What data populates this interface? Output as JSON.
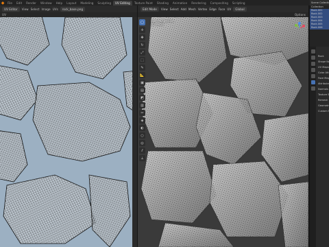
{
  "topbar": {
    "tabs": [
      "File",
      "Edit",
      "Render",
      "Window",
      "Help",
      "Layout",
      "Modeling",
      "Sculpting",
      "UV Editing",
      "Texture Paint",
      "Shading",
      "Animation",
      "Rendering",
      "Compositing",
      "Scripting"
    ],
    "active_tab": "UV Editing",
    "scene": "Scene"
  },
  "uv_editor": {
    "mode_label": "UV Editor",
    "menus": [
      "View",
      "Select",
      "Image",
      "UVs"
    ],
    "image_name": "rock_base.png",
    "sync_label": "UV"
  },
  "viewport": {
    "mode": "Edit Mode",
    "menus": [
      "View",
      "Select",
      "Add",
      "Mesh",
      "Vertex",
      "Edge",
      "Face",
      "UV"
    ],
    "orientation": "Global",
    "options_label": "Options",
    "info_lines": [
      "User Perspective",
      "(1) Rocks"
    ]
  },
  "outliner": {
    "title": "Scene Collection",
    "rows": [
      "Collection",
      "Rock.001",
      "Rock.002",
      "Rock.003",
      "Rock.004",
      "Rock.005",
      "Rock.006"
    ]
  },
  "properties": {
    "rows": [
      "Rock",
      "Shape Keys",
      "UV Maps",
      "Color Attributes",
      "Face Maps",
      "Attributes",
      "Normals",
      "Texture Space",
      "Remesh",
      "Geometry Data",
      "Custom Props"
    ]
  },
  "colors": {
    "accent": "#4772b3",
    "uv_background": "#9cb0c2",
    "blender_orange": "#e87d0d"
  },
  "icons": {
    "logo": "blender-logo-icon",
    "tools": [
      "select-box-icon",
      "cursor-icon",
      "move-icon",
      "rotate-icon",
      "scale-icon",
      "transform-icon",
      "annotate-icon",
      "measure-icon",
      "extrude-icon",
      "inset-icon",
      "bevel-icon",
      "loop-cut-icon",
      "knife-icon",
      "poly-build-icon",
      "spin-icon",
      "smooth-icon",
      "shrink-icon",
      "shear-icon",
      "rip-icon"
    ]
  }
}
